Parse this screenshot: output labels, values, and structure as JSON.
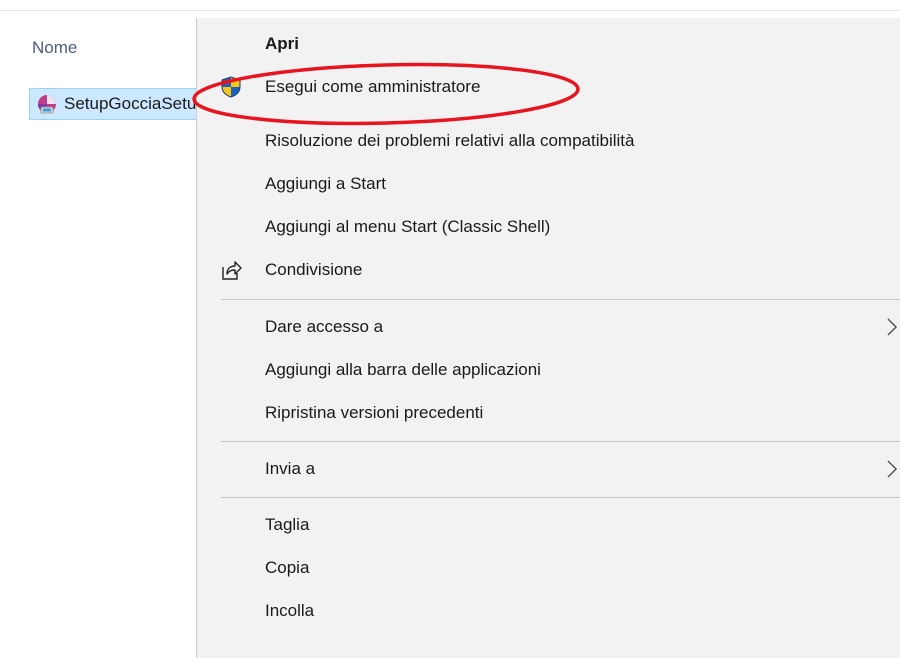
{
  "explorer": {
    "column_header": "Nome",
    "selected_file": "SetupGocciaSetup"
  },
  "context_menu": {
    "items": [
      {
        "label": "Apri",
        "bold": true,
        "icon": null,
        "submenu": false
      },
      {
        "label": "Esegui come amministratore",
        "bold": false,
        "icon": "shield-icon",
        "submenu": false
      },
      {
        "label": "Risoluzione dei problemi relativi alla compatibilità",
        "bold": false,
        "icon": null,
        "submenu": false
      },
      {
        "label": "Aggiungi a Start",
        "bold": false,
        "icon": null,
        "submenu": false
      },
      {
        "label": "Aggiungi al menu Start (Classic Shell)",
        "bold": false,
        "icon": null,
        "submenu": false
      },
      {
        "label": "Condivisione",
        "bold": false,
        "icon": "share-icon",
        "submenu": false
      },
      {
        "label": "Dare accesso a",
        "bold": false,
        "icon": null,
        "submenu": true
      },
      {
        "label": "Aggiungi alla barra delle applicazioni",
        "bold": false,
        "icon": null,
        "submenu": false
      },
      {
        "label": "Ripristina versioni precedenti",
        "bold": false,
        "icon": null,
        "submenu": false
      },
      {
        "label": "Invia a",
        "bold": false,
        "icon": null,
        "submenu": true
      },
      {
        "label": "Taglia",
        "bold": false,
        "icon": null,
        "submenu": false
      },
      {
        "label": "Copia",
        "bold": false,
        "icon": null,
        "submenu": false
      },
      {
        "label": "Incolla",
        "bold": false,
        "icon": null,
        "submenu": false
      }
    ]
  },
  "colors": {
    "menu_background": "#f2f2f2",
    "selection_background": "#cce8ff",
    "annotation_red": "#e8141e",
    "shield_blue": "#1f5fbf",
    "shield_yellow": "#f5c518"
  }
}
